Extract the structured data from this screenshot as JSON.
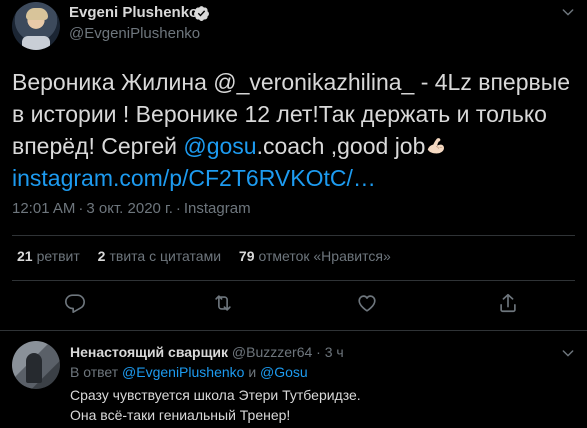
{
  "tweet": {
    "author_name": "Evgeni Plushenko",
    "author_handle": "@EvgeniPlushenko",
    "text_part1": "Вероника Жилина @_veronikazhilina_  - 4Lz  впервые в истории ! Веронике 12 лет!Так держать и только вперёд! Сергей ",
    "mention_gosu": "@gosu",
    "text_part2": ".coach ,good job",
    "emoji": "flexed-biceps",
    "link": "instagram.com/p/CF2T6RVKOtC/…",
    "time": "12:01 AM",
    "date": "3 окт. 2020 г.",
    "source": "Instagram",
    "meta_sep1": "·",
    "meta_sep2": "·"
  },
  "stats": {
    "retweets_count": "21",
    "retweets_label": "ретвит",
    "quotes_count": "2",
    "quotes_label": "твита с цитатами",
    "likes_count": "79",
    "likes_label": "отметок «Нравится»"
  },
  "actions": [
    "reply-icon",
    "retweet-icon",
    "like-icon",
    "share-icon"
  ],
  "reply": {
    "name": "Ненастоящий сварщик",
    "handle": "@Buzzzer64",
    "dot": "·",
    "time": "3 ч",
    "reply_to_prefix": "В ответ ",
    "reply_to_user1": "@EvgeniPlushenko",
    "reply_to_and": " и ",
    "reply_to_user2": "@Gosu",
    "text_line1": "Сразу чувствуется школа Этери Тутберидзе.",
    "text_line2": "Она всё-таки гениальный Тренер!"
  },
  "colors": {
    "background": "#000000",
    "text": "#d9d9d9",
    "muted": "#6e767d",
    "link": "#1d9bf0",
    "divider": "#2f3336"
  }
}
